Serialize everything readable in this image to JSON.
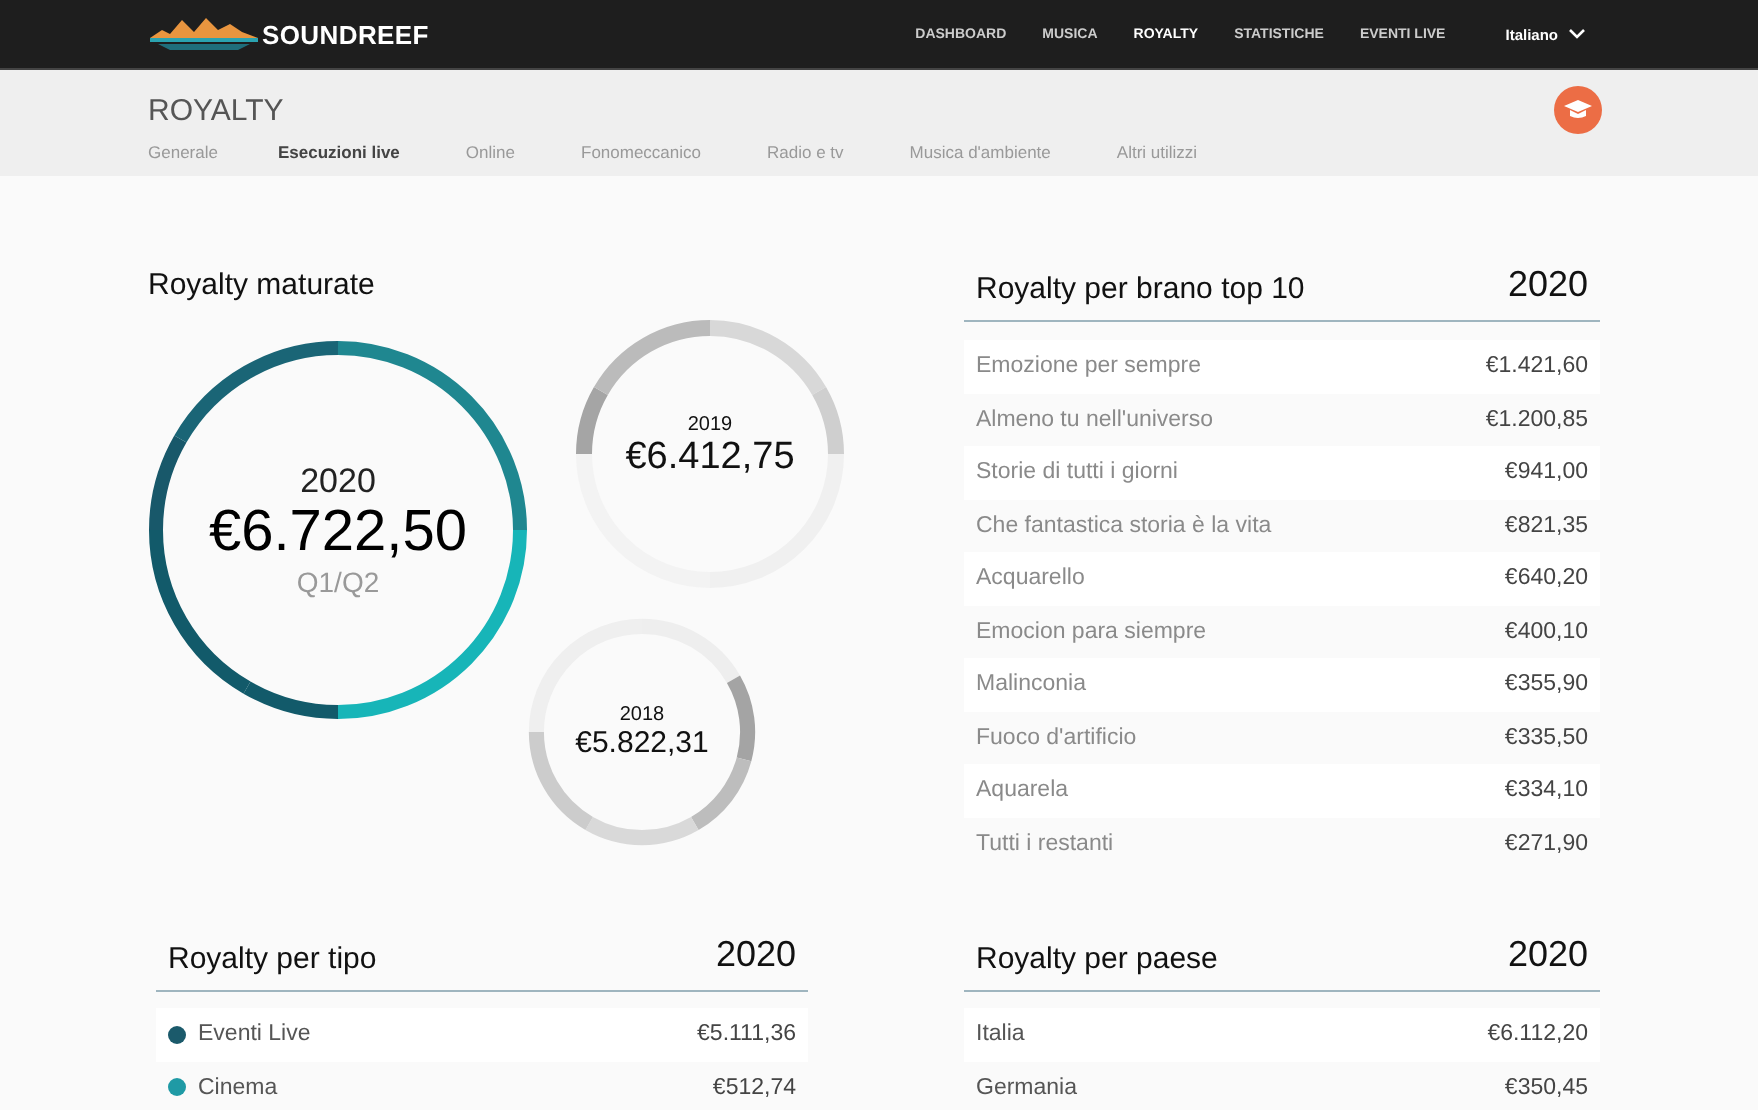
{
  "navbar": {
    "logo": "SOUNDREEF",
    "links": [
      {
        "label": "DASHBOARD",
        "selected": false
      },
      {
        "label": "MUSICA",
        "selected": false
      },
      {
        "label": "ROYALTY",
        "selected": true
      },
      {
        "label": "STATISTICHE",
        "selected": false
      },
      {
        "label": "EVENTI LIVE",
        "selected": false
      }
    ],
    "language": "Italiano"
  },
  "page": {
    "title": "ROYALTY",
    "tabs": [
      {
        "label": "Generale",
        "selected": false
      },
      {
        "label": "Esecuzioni live",
        "selected": true
      },
      {
        "label": "Online",
        "selected": false
      },
      {
        "label": "Fonomeccanico",
        "selected": false
      },
      {
        "label": "Radio e tv",
        "selected": false
      },
      {
        "label": "Musica d'ambiente",
        "selected": false
      },
      {
        "label": "Altri utilizzi",
        "selected": false
      }
    ]
  },
  "royalty_maturate": {
    "title": "Royalty maturate",
    "main": {
      "year": "2020",
      "amount": "€6.722,50",
      "period": "Q1/Q2"
    },
    "previous": [
      {
        "year": "2019",
        "amount": "€6.412,75"
      },
      {
        "year": "2018",
        "amount": "€5.822,31"
      }
    ]
  },
  "top_tracks": {
    "title": "Royalty per brano top 10",
    "year": "2020",
    "rows": [
      {
        "name": "Emozione per sempre",
        "amount": "€1.421,60"
      },
      {
        "name": "Almeno tu nell'universo",
        "amount": "€1.200,85"
      },
      {
        "name": "Storie di tutti i giorni",
        "amount": "€941,00"
      },
      {
        "name": "Che fantastica storia è la vita",
        "amount": "€821,35"
      },
      {
        "name": "Acquarello",
        "amount": "€640,20"
      },
      {
        "name": "Emocion para siempre",
        "amount": "€400,10"
      },
      {
        "name": "Malinconia",
        "amount": "€355,90"
      },
      {
        "name": "Fuoco d'artificio",
        "amount": "€335,50"
      },
      {
        "name": "Aquarela",
        "amount": "€334,10"
      },
      {
        "name": "Tutti i restanti",
        "amount": "€271,90"
      }
    ]
  },
  "by_type": {
    "title": "Royalty per tipo",
    "year": "2020",
    "rows": [
      {
        "name": "Eventi Live",
        "amount": "€5.111,36",
        "color": "#1b5a6b"
      },
      {
        "name": "Cinema",
        "amount": "€512,74",
        "color": "#1f9aa5"
      }
    ]
  },
  "by_country": {
    "title": "Royalty per paese",
    "year": "2020",
    "rows": [
      {
        "name": "Italia",
        "amount": "€6.112,20"
      },
      {
        "name": "Germania",
        "amount": "€350,45"
      }
    ]
  }
}
